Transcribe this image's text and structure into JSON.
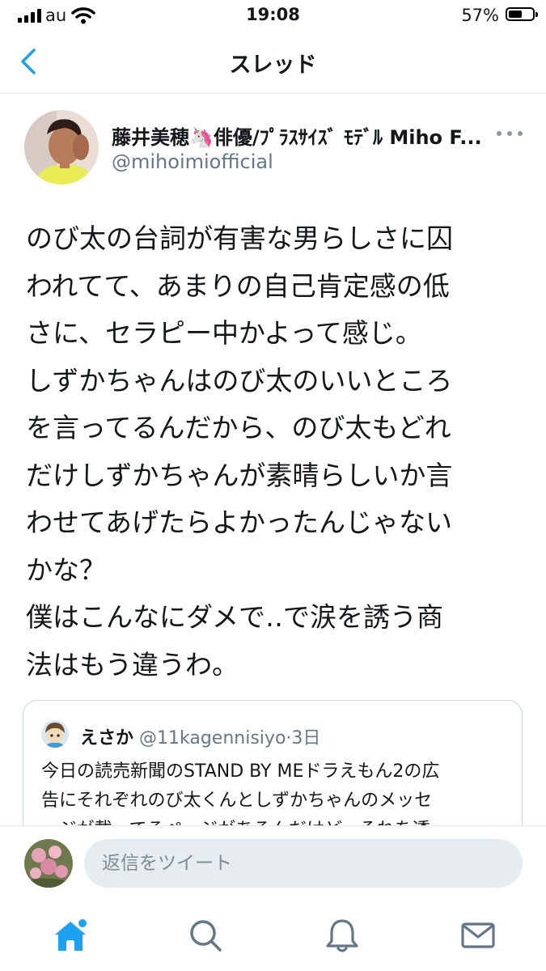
{
  "status_bar": {
    "carrier": "au",
    "time": "19:08",
    "battery_percent_label": "57%",
    "battery_level": 0.57
  },
  "header": {
    "title": "スレッド"
  },
  "tweet": {
    "author_name": "藤井美穂🦄俳優/ﾌﾟﾗｽｻｲｽﾞ ﾓﾃﾞﾙ Miho F...",
    "author_handle": "@mihoimiofficial",
    "text_lines": [
      "のび太の台詞が有害な男らしさに囚",
      "われてて、あまりの自己肯定感の低",
      "さに、セラピー中かよって感じ。",
      "しずかちゃんはのび太のいいところ",
      "を言ってるんだから、のび太もどれ",
      "だけしずかちゃんが素晴らしいか言",
      "わせてあげたらよかったんじゃない",
      "かな？",
      "僕はこんなにダメで‥で涙を誘う商",
      "法はもう違うわ。"
    ]
  },
  "quoted_tweet": {
    "name": "えさか",
    "handle": "@11kagennisiyo",
    "separator": "·",
    "time": "3日",
    "text_lines": [
      "今日の読売新聞のSTAND BY MEドラえもん2の広",
      "告にそれぞれのび太くんとしずかちゃんのメッセ",
      "ージが載ってるページがあるんだけど、それを透"
    ]
  },
  "reply": {
    "placeholder": "返信をツイート"
  },
  "tabs": [
    {
      "icon": "home-icon",
      "active": true,
      "notification_dot": true
    },
    {
      "icon": "search-icon",
      "active": false
    },
    {
      "icon": "bell-icon",
      "active": false
    },
    {
      "icon": "mail-icon",
      "active": false
    }
  ],
  "colors": {
    "accent": "#1da1f2",
    "text": "#14171a",
    "secondary": "#657786",
    "border": "#e1e8ed"
  }
}
